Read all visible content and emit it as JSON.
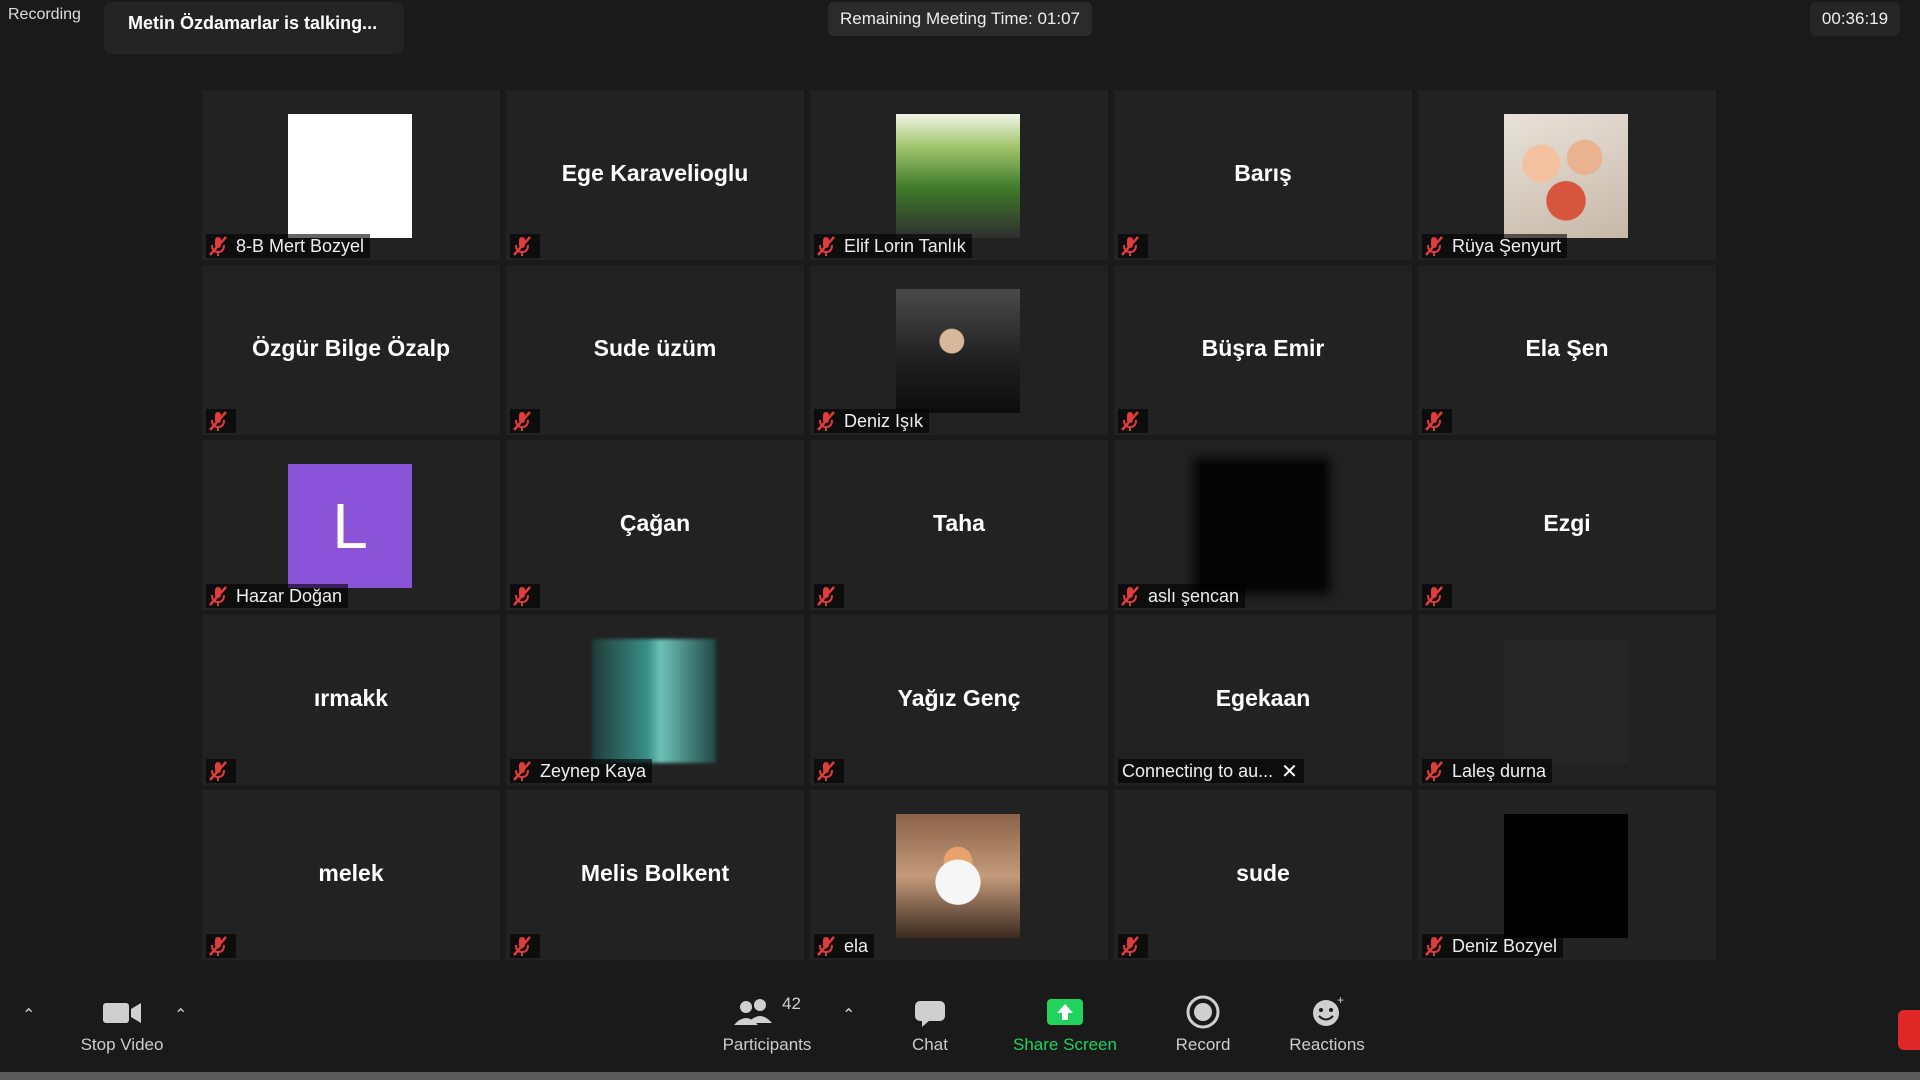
{
  "topbar": {
    "recording": "Recording",
    "talking": "Metin Özdamarlar is talking...",
    "remaining": "Remaining Meeting Time: 01:07",
    "clock": "00:36:19"
  },
  "tiles": [
    {
      "thumb": "th-white",
      "label": "8-B Mert Bozyel"
    },
    {
      "name": "Ege Karavelioglu"
    },
    {
      "thumb": "th-plant",
      "label": "Elif Lorin Tanlık"
    },
    {
      "name": "Barış"
    },
    {
      "thumb": "th-friends",
      "label": "Rüya Şenyurt"
    },
    {
      "name": "Özgür Bilge Özalp"
    },
    {
      "name": "Sude üzüm"
    },
    {
      "thumb": "th-portrait",
      "label": "Deniz Işık"
    },
    {
      "name": "Büşra Emir"
    },
    {
      "name": "Ela Şen"
    },
    {
      "thumb": "th-purple",
      "letter": "L",
      "label": "Hazar Doğan"
    },
    {
      "name": "Çağan"
    },
    {
      "name": "Taha"
    },
    {
      "thumb": "th-black",
      "label": "aslı şencan"
    },
    {
      "name": "Ezgi"
    },
    {
      "name": "ırmakk"
    },
    {
      "thumb": "th-teal",
      "label": "Zeynep Kaya"
    },
    {
      "name": "Yağız Genç"
    },
    {
      "name": "Egekaan",
      "connecting": "Connecting to au...",
      "nomic": true
    },
    {
      "thumb": "th-faint",
      "label": "Laleş durna"
    },
    {
      "name": "melek"
    },
    {
      "name": "Melis Bolkent"
    },
    {
      "thumb": "th-face",
      "label": "ela"
    },
    {
      "name": "sude"
    },
    {
      "thumb": "th-pureblack",
      "label": "Deniz Bozyel"
    }
  ],
  "toolbar": {
    "stop_video": "Stop Video",
    "participants": "Participants",
    "participants_count": "42",
    "chat": "Chat",
    "share_screen": "Share Screen",
    "record": "Record",
    "reactions": "Reactions"
  },
  "colors": {
    "background": "#1a1a1a",
    "tile": "#222222",
    "muted_icon": "#e03c3c",
    "share_green": "#1fd35c",
    "end_red": "#e02828"
  }
}
